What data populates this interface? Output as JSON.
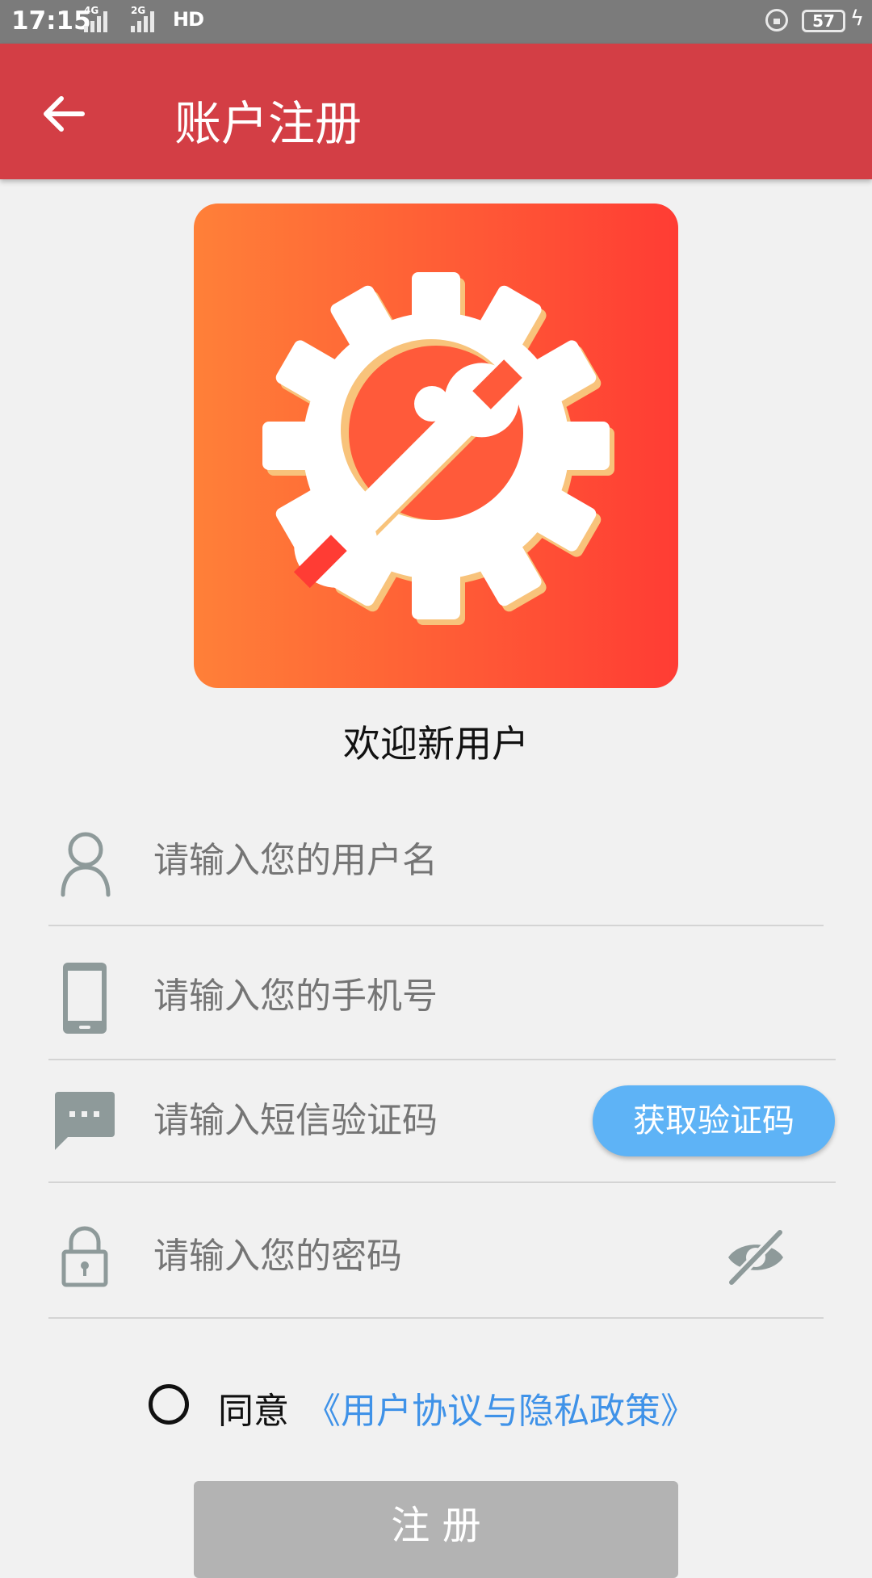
{
  "status_bar": {
    "time": "17:15",
    "net_1": "4G",
    "net_2": "2G",
    "hd": "HD",
    "battery": "57"
  },
  "app_bar": {
    "title": "账户注册"
  },
  "welcome": "欢迎新用户",
  "form": {
    "username_placeholder": "请输入您的用户名",
    "phone_placeholder": "请输入您的手机号",
    "sms_placeholder": "请输入短信验证码",
    "password_placeholder": "请输入您的密码",
    "get_code_label": "获取验证码"
  },
  "agreement": {
    "prefix": "同意",
    "link": "《用户协议与隐私政策》",
    "checked": false
  },
  "register_label": "注 册",
  "colors": {
    "app_bar": "#d33e45",
    "logo_gradient_start": "#ff8038",
    "logo_gradient_end": "#ff3c34",
    "accent_blue": "#5eb3f6",
    "link_blue": "#3f92e8",
    "icon_gray": "#8e9a9a",
    "disabled_button": "#b3b3b3"
  },
  "icons": [
    "back-arrow-icon",
    "gear-wrench-icon",
    "user-icon",
    "phone-icon",
    "message-icon",
    "lock-icon",
    "eye-off-icon"
  ]
}
